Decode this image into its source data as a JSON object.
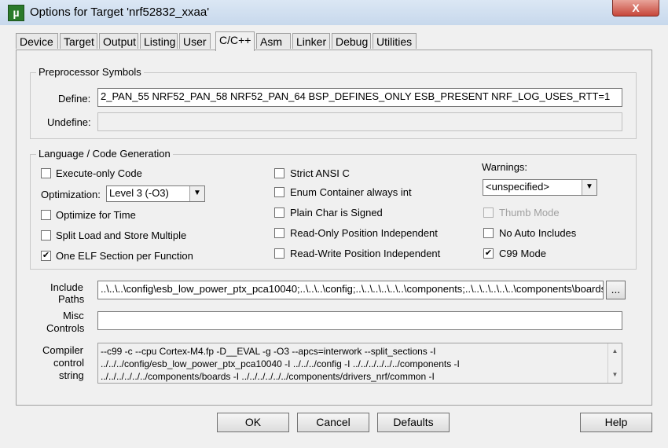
{
  "window": {
    "title": "Options for Target 'nrf52832_xxaa'",
    "app_icon": "µ",
    "close_glyph": "X"
  },
  "tabs": [
    "Device",
    "Target",
    "Output",
    "Listing",
    "User",
    "C/C++",
    "Asm",
    "Linker",
    "Debug",
    "Utilities"
  ],
  "preprocessor": {
    "group_title": "Preprocessor Symbols",
    "define_label": "Define:",
    "define_value": "2_PAN_55 NRF52_PAN_58 NRF52_PAN_64 BSP_DEFINES_ONLY ESB_PRESENT NRF_LOG_USES_RTT=1",
    "undefine_label": "Undefine:",
    "undefine_value": ""
  },
  "language": {
    "group_title": "Language / Code Generation",
    "execute_only": {
      "label": "Execute-only Code",
      "checked": ""
    },
    "optimization_label": "Optimization:",
    "optimization_value": "Level 3 (-O3)",
    "optimize_time": {
      "label": "Optimize for Time",
      "checked": ""
    },
    "split_load": {
      "label": "Split Load and Store Multiple",
      "checked": ""
    },
    "one_elf": {
      "label": "One ELF Section per Function",
      "checked": "✔"
    },
    "strict_ansi": {
      "label": "Strict ANSI C",
      "checked": ""
    },
    "enum_container": {
      "label": "Enum Container always int",
      "checked": ""
    },
    "plain_char": {
      "label": "Plain Char is Signed",
      "checked": ""
    },
    "ro_pos": {
      "label": "Read-Only Position Independent",
      "checked": ""
    },
    "rw_pos": {
      "label": "Read-Write Position Independent",
      "checked": ""
    },
    "warnings_label": "Warnings:",
    "warnings_value": "<unspecified>",
    "thumb_mode": {
      "label": "Thumb Mode",
      "checked": ""
    },
    "no_auto_includes": {
      "label": "No Auto Includes",
      "checked": ""
    },
    "c99_mode": {
      "label": "C99 Mode",
      "checked": "✔"
    }
  },
  "include": {
    "label_line1": "Include",
    "label_line2": "Paths",
    "value": "..\\..\\..\\config\\esb_low_power_ptx_pca10040;..\\..\\..\\config;..\\..\\..\\..\\..\\..\\components;..\\..\\..\\..\\..\\..\\components\\boards;",
    "browse_label": "..."
  },
  "misc": {
    "label_line1": "Misc",
    "label_line2": "Controls",
    "value": ""
  },
  "compiler": {
    "label_line1": "Compiler",
    "label_line2": "control",
    "label_line3": "string",
    "line1": "--c99 -c --cpu Cortex-M4.fp -D__EVAL -g -O3 --apcs=interwork --split_sections -I",
    "line2": "../../../config/esb_low_power_ptx_pca10040 -I ../../../config -I ../../../../../../components -I",
    "line3": "../../../../../../components/boards -I ../../../../../../components/drivers_nrf/common -I"
  },
  "buttons": {
    "ok": "OK",
    "cancel": "Cancel",
    "defaults": "Defaults",
    "help": "Help"
  },
  "icons": {
    "dropdown_arrow": "▼",
    "scroll_up": "▲",
    "scroll_down": "▼"
  }
}
